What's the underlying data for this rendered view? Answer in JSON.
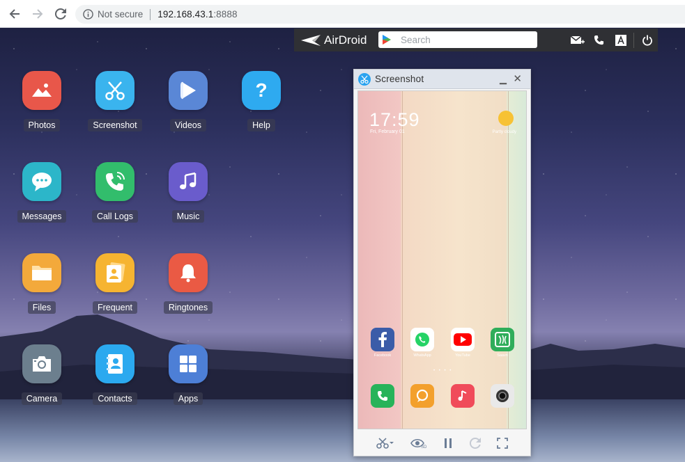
{
  "browser": {
    "security_text": "Not secure",
    "url_host": "192.168.43.1",
    "url_port": ":8888"
  },
  "topbar": {
    "brand": "AirDroid",
    "search_placeholder": "Search",
    "icons": [
      "message-icon",
      "phone-icon",
      "font-icon",
      "power-icon"
    ]
  },
  "apps": [
    {
      "label": "Photos",
      "color": "#e8574a",
      "icon": "photos-icon"
    },
    {
      "label": "Screenshot",
      "color": "#3ab4ee",
      "icon": "scissors-icon"
    },
    {
      "label": "Videos",
      "color": "#5a87d6",
      "icon": "play-icon"
    },
    {
      "label": "Help",
      "color": "#2eaaf0",
      "icon": "help-icon"
    },
    {
      "label": "Messages",
      "color": "#2cb6c9",
      "icon": "chat-icon"
    },
    {
      "label": "Call Logs",
      "color": "#32bd6c",
      "icon": "phone-icon"
    },
    {
      "label": "Music",
      "color": "#6a5ccc",
      "icon": "music-icon"
    },
    {
      "label": "Files",
      "color": "#f3a93b",
      "icon": "folder-icon"
    },
    {
      "label": "Frequent",
      "color": "#f6b431",
      "icon": "contact-card-icon"
    },
    {
      "label": "Ringtones",
      "color": "#ea5a44",
      "icon": "bell-icon"
    },
    {
      "label": "Camera",
      "color": "#6c7f8e",
      "icon": "camera-icon"
    },
    {
      "label": "Contacts",
      "color": "#2ba9ef",
      "icon": "contacts-book-icon"
    },
    {
      "label": "Apps",
      "color": "#4d7fd6",
      "icon": "grid-icon"
    }
  ],
  "screenshot_window": {
    "title": "Screenshot",
    "phone": {
      "time": "17:59",
      "date": "Fri, February 01",
      "weather": "Partly cloudy",
      "apps": [
        {
          "label": "Facebook",
          "color": "#3b5ca8"
        },
        {
          "label": "WhatsApp",
          "color": "#ffffff"
        },
        {
          "label": "YouTube",
          "color": "#ffffff"
        },
        {
          "label": "Saavn",
          "color": "#2fad5a"
        }
      ],
      "dock": [
        {
          "name": "phone",
          "color": "#27b35a"
        },
        {
          "name": "messages",
          "color": "#f3a02c"
        },
        {
          "name": "music",
          "color": "#f04b5a"
        },
        {
          "name": "camera",
          "color": "#e9e9e9"
        }
      ]
    },
    "toolbar": [
      "scissors-icon",
      "eye-icon",
      "pause-icon",
      "refresh-icon",
      "fullscreen-icon"
    ]
  }
}
